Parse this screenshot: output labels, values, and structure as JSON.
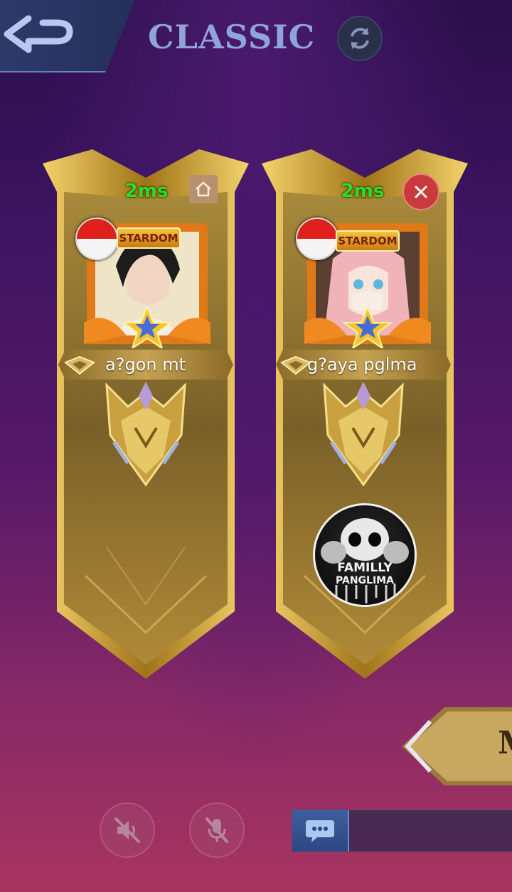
{
  "header": {
    "mode_title": "CLASSIC"
  },
  "players": [
    {
      "ping": "2ms",
      "name": "a?gon mt",
      "badge": "STARDOM",
      "status_icon": "home-icon",
      "flag": "indonesia-flag-icon"
    },
    {
      "ping": "2ms",
      "name": "g?aya pglma",
      "badge": "STARDOM",
      "status_icon": "close-icon",
      "flag": "indonesia-flag-icon"
    }
  ],
  "squad": {
    "line1": "FAMILLY",
    "line2": "PANGLIMA"
  },
  "start_button": {
    "label": "M"
  },
  "colors": {
    "ping": "#2bdc2b",
    "accent_gold": "#c6a252",
    "title": "#8fa4d8"
  }
}
